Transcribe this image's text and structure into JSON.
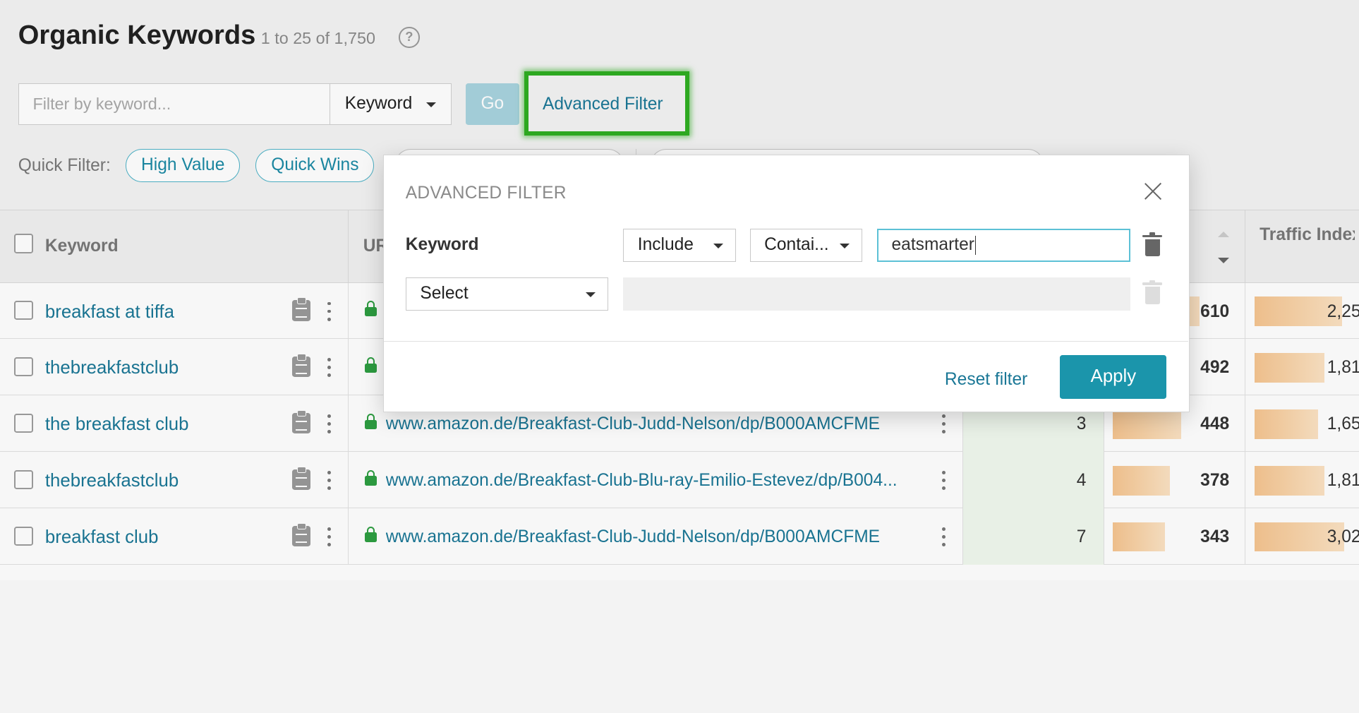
{
  "header": {
    "title": "Organic Keywords",
    "count": "1 to 25 of 1,750",
    "help_icon": "?"
  },
  "filter_bar": {
    "search_placeholder": "Filter by keyword...",
    "search_value": "",
    "field_select": "Keyword",
    "go_label": "Go",
    "advanced_filter_label": "Advanced Filter"
  },
  "quick_filter": {
    "label": "Quick Filter:",
    "chips": [
      "High Value",
      "Quick Wins"
    ]
  },
  "table": {
    "columns": {
      "keyword": "Keyword",
      "url": "URL",
      "traffic_index": "Traffic Index..."
    },
    "rows": [
      {
        "keyword": "breakfast at tiffa",
        "url": "",
        "position": "",
        "volume": "610",
        "volume_frac": 0.7,
        "traffic_index": "2,25",
        "traffic_frac": 0.97
      },
      {
        "keyword": "thebreakfastclub",
        "url": "",
        "position": "",
        "volume": "492",
        "volume_frac": 0.6,
        "traffic_index": "1,81",
        "traffic_frac": 0.78
      },
      {
        "keyword": "the breakfast club",
        "url": "www.amazon.de/Breakfast-Club-Judd-Nelson/dp/B000AMCFME",
        "position": "3",
        "volume": "448",
        "volume_frac": 0.55,
        "traffic_index": "1,65",
        "traffic_frac": 0.71
      },
      {
        "keyword": "thebreakfastclub",
        "url": "www.amazon.de/Breakfast-Club-Blu-ray-Emilio-Estevez/dp/B004...",
        "position": "4",
        "volume": "378",
        "volume_frac": 0.46,
        "traffic_index": "1,81",
        "traffic_frac": 0.78
      },
      {
        "keyword": "breakfast club",
        "url": "www.amazon.de/Breakfast-Club-Judd-Nelson/dp/B000AMCFME",
        "position": "7",
        "volume": "343",
        "volume_frac": 0.42,
        "traffic_index": "3,02",
        "traffic_frac": 1.0
      }
    ]
  },
  "modal": {
    "title": "ADVANCED FILTER",
    "rule1": {
      "field": "Keyword",
      "mode": "Include",
      "operator": "Contai...",
      "value": "eatsmarter"
    },
    "rule2": {
      "field_placeholder": "Select"
    },
    "reset_label": "Reset filter",
    "apply_label": "Apply"
  },
  "colors": {
    "accent": "#1b95ab",
    "link": "#1a7796",
    "highlight": "#2fae22"
  },
  "icons": [
    "help-icon",
    "caret-down-icon",
    "checkbox-icon",
    "clipboard-icon",
    "kebab-menu-icon",
    "lock-icon",
    "sort-icon",
    "close-icon",
    "trash-icon"
  ]
}
